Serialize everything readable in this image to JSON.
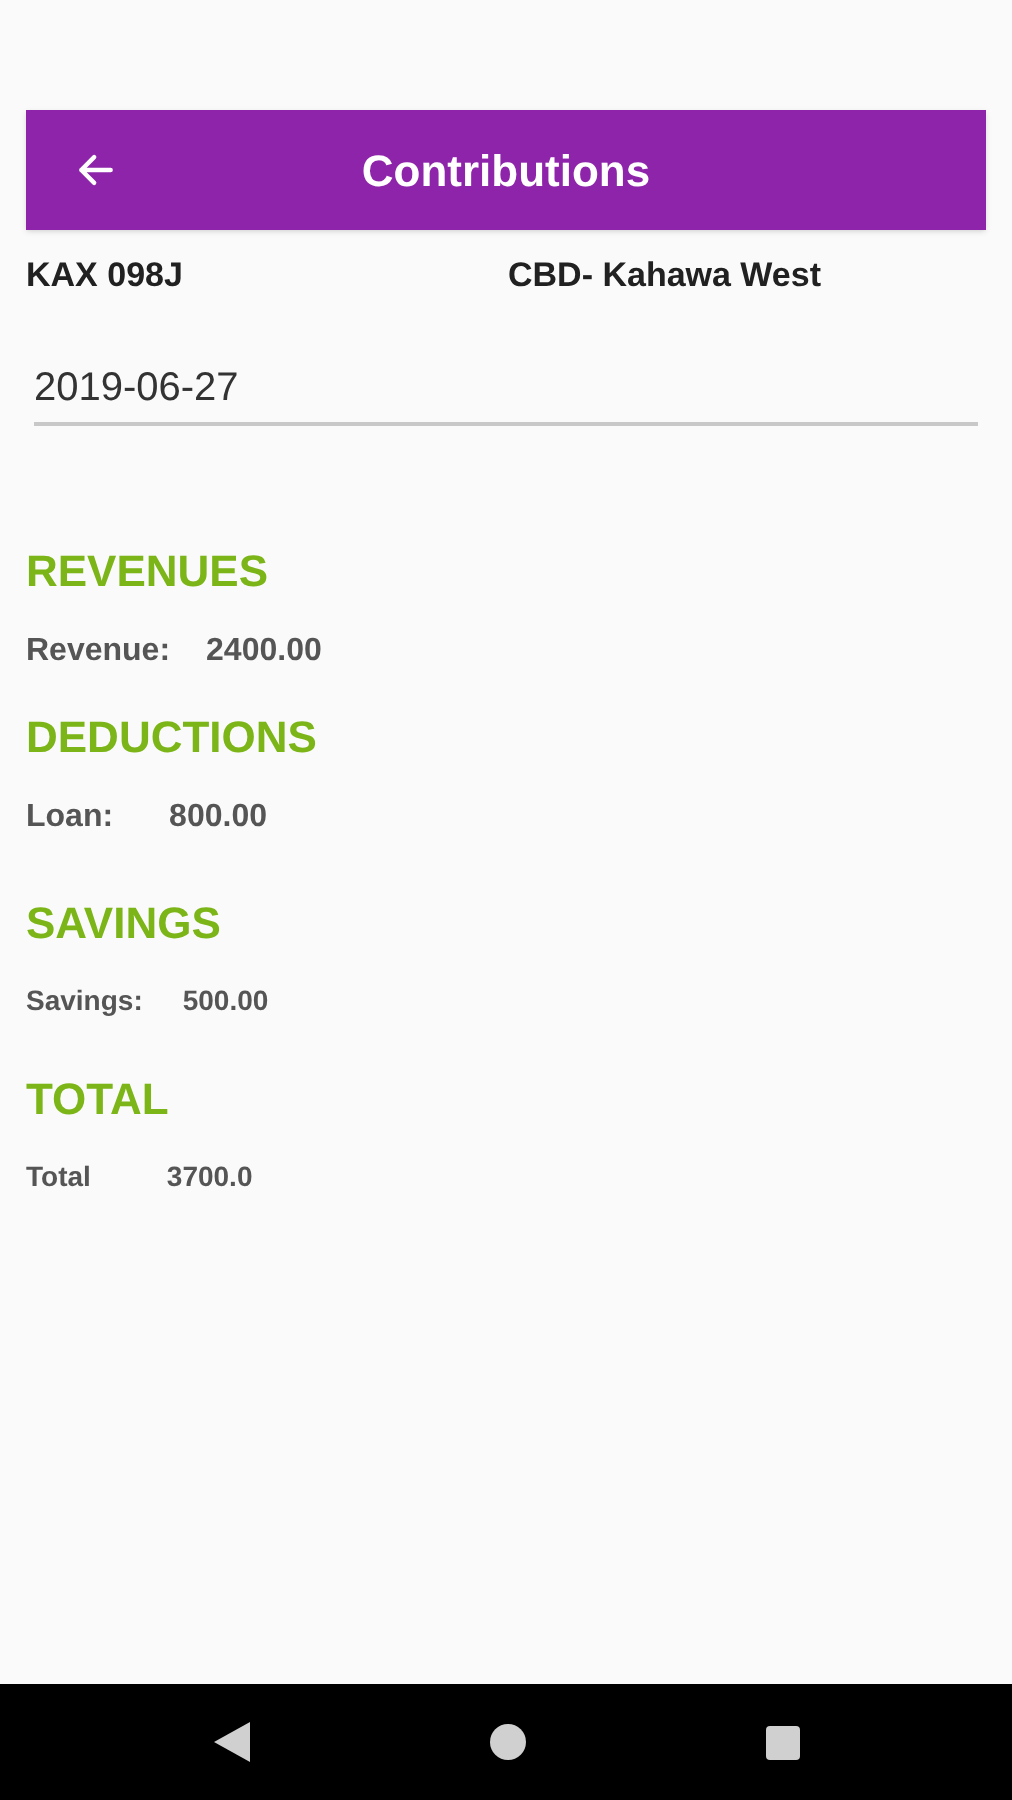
{
  "app_bar": {
    "title": "Contributions"
  },
  "vehicle": {
    "plate": "KAX 098J",
    "route": "CBD- Kahawa West"
  },
  "date_field": {
    "value": "2019-06-27"
  },
  "sections": [
    {
      "heading": "REVENUES",
      "label": "Revenue:",
      "value": "2400.00"
    },
    {
      "heading": "DEDUCTIONS",
      "label": "Loan:",
      "value": "800.00"
    },
    {
      "heading": "SAVINGS",
      "label": "Savings:",
      "value": "500.00"
    },
    {
      "heading": "TOTAL",
      "label": "Total",
      "value": "3700.0"
    }
  ]
}
